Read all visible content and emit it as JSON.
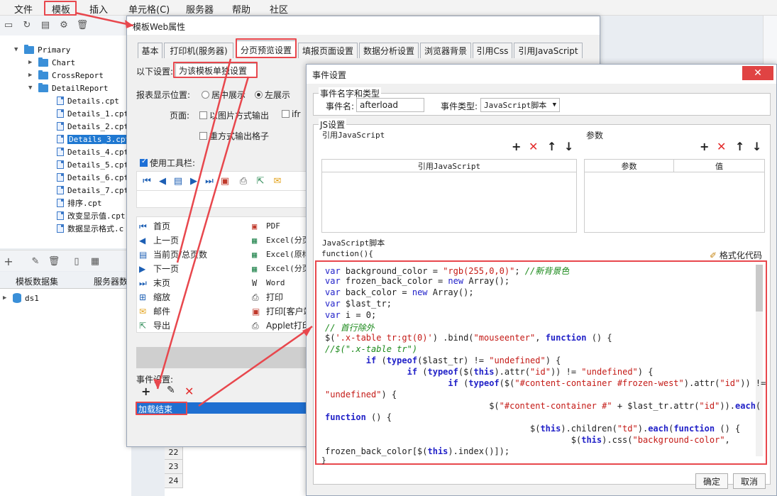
{
  "menubar": {
    "items": [
      "文件",
      "模板",
      "插入",
      "单元格(C)",
      "服务器",
      "帮助",
      "社区"
    ]
  },
  "tree": {
    "root": "Primary",
    "folders": [
      "Chart",
      "CrossReport",
      "DetailReport"
    ],
    "files": [
      "Details.cpt",
      "Details_1.cpt",
      "Details_2.cpt",
      "Details_3.cpt",
      "Details_4.cpt",
      "Details_5.cpt",
      "Details_6.cpt",
      "Details_7.cpt",
      "排序.cpt",
      "改变显示值.cpt",
      "数据显示格式.c"
    ],
    "selected": "Details_3.cpt"
  },
  "dataset_tabs": [
    "模板数据集",
    "服务器数"
  ],
  "dataset_item": "ds1",
  "sheet_rows": [
    "22",
    "23",
    "24"
  ],
  "web_window": {
    "title": "模板Web属性",
    "tabs": [
      "基本",
      "打印机(服务器)",
      "分页预览设置",
      "填报页面设置",
      "数据分析设置",
      "浏览器背景",
      "引用Css",
      "引用JavaScript"
    ],
    "active_tab": "分页预览设置",
    "setting_label": "以下设置:",
    "setting_value": "为该模板单独设置",
    "position_label": "报表显示位置:",
    "position_center": "居中展示",
    "position_left": "左展示",
    "page_label": "页面:",
    "opt_image": "以图片方式输出",
    "opt_iframe": "ifr",
    "opt_repeat": "重方式输出格子",
    "use_toolbar": "使用工具栏:",
    "list_left": [
      "首页",
      "上一页",
      "当前页/总页数",
      "下一页",
      "末页",
      "缩放",
      "邮件",
      "导出"
    ],
    "list_right": [
      "PDF",
      "Excel(分页",
      "Excel(原样",
      "Excel(分页",
      "Word",
      "打印",
      "打印[客户端",
      "Applet打印"
    ],
    "event_label": "事件设置:",
    "event_item": "加载结束"
  },
  "event_window": {
    "title": "事件设置",
    "name_group": "事件名字和类型",
    "event_name_label": "事件名:",
    "event_name_value": "afterload",
    "event_type_label": "事件类型:",
    "event_type_value": "JavaScript脚本",
    "js_group": "JS设置",
    "ref_js_label": "引用JavaScript",
    "params_label": "参数",
    "ref_js_col": "引用JavaScript",
    "param_col": "参数",
    "value_col": "值",
    "script_label": "JavaScript脚本",
    "function_open": "function(){",
    "format_code": "格式化代码",
    "function_close": "}",
    "ok": "确定",
    "cancel": "取消",
    "code": [
      "var background_color = \"rgb(255,0,0)\"; //新背景色",
      "var frozen_back_color = new Array();",
      "var back_color = new Array();",
      "var $last_tr;",
      "var i = 0;",
      "// 首行除外",
      "$('.x-table tr:gt(0)') .bind(\"mouseenter\", function () {",
      "//$(\".x-table tr\")",
      "        if (typeof($last_tr) != \"undefined\") {",
      "                if (typeof($(this).attr(\"id\")) != \"undefined\") {",
      "                        if (typeof($(\"#content-container #frozen-west\").attr(\"id\")) !=",
      "\"undefined\") {",
      "                                $(\"#content-container #\" + $last_tr.attr(\"id\")).each(",
      "function () {",
      "                                        $(this).children(\"td\").each(function () {",
      "                                                $(this).css(\"background-color\",",
      "frozen_back_color[$(this).index()]);"
    ]
  }
}
